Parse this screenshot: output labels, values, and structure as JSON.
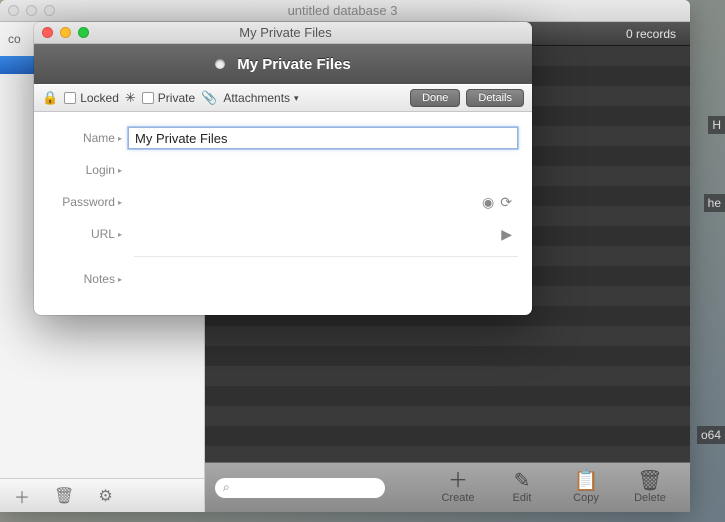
{
  "main": {
    "title": "untitled database 3",
    "sidebar_label_fragment": "co",
    "records_count": "0 records"
  },
  "footer": {
    "create": "Create",
    "edit": "Edit",
    "copy": "Copy",
    "delete": "Delete",
    "search_placeholder": ""
  },
  "modal": {
    "window_title": "My Private Files",
    "header_title": "My Private Files",
    "toolbar": {
      "locked": "Locked",
      "private": "Private",
      "attachments": "Attachments"
    },
    "buttons": {
      "done": "Done",
      "details": "Details"
    },
    "fields": {
      "name_label": "Name",
      "name_value": "My Private Files",
      "login_label": "Login",
      "password_label": "Password",
      "url_label": "URL",
      "notes_label": "Notes"
    }
  },
  "edge": {
    "right1": "H",
    "right2": "he",
    "right3": "o64"
  }
}
